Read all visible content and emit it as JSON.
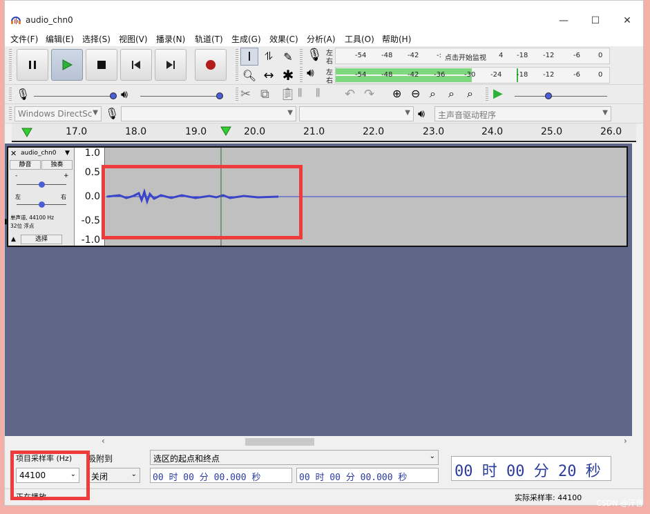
{
  "window": {
    "title": "audio_chn0",
    "minimize": "—",
    "maximize": "☐",
    "close": "✕"
  },
  "menu": [
    "文件(F)",
    "编辑(E)",
    "选择(S)",
    "视图(V)",
    "播录(N)",
    "轨道(T)",
    "生成(G)",
    "效果(C)",
    "分析(A)",
    "工具(O)",
    "帮助(H)"
  ],
  "meters": {
    "rec_lr": [
      "左",
      "右"
    ],
    "play_lr": [
      "左",
      "右"
    ],
    "rec_scale": [
      "-54",
      "-48",
      "-42",
      "-:",
      "点击开始监视",
      "4",
      "-18",
      "-12",
      "-6",
      "0"
    ],
    "play_scale": [
      "-54",
      "-48",
      "-42",
      "-36",
      "-30",
      "-24",
      "-18",
      "-12",
      "-6",
      "0"
    ]
  },
  "device": {
    "host": "Windows DirectSc",
    "input_device": "",
    "input_channels": "",
    "output_device": "主声音驱动程序"
  },
  "ruler": [
    "17.0",
    "18.0",
    "19.0",
    "20.0",
    "21.0",
    "22.0",
    "23.0",
    "24.0",
    "25.0",
    "26.0"
  ],
  "track": {
    "name": "audio_chn0",
    "mute": "静音",
    "solo": "独奏",
    "pan_left": "左",
    "pan_right": "右",
    "info1": "单声道, 44100 Hz",
    "info2": "32位 浮点",
    "select": "选择",
    "vruler": [
      "1.0",
      "0.5",
      "0.0",
      "-0.5",
      "-1.0"
    ]
  },
  "bottom": {
    "rate_label": "项目采样率 (Hz)",
    "rate_value": "44100",
    "snap_label": "吸附到",
    "snap_value": "关闭",
    "sel_mode": "选区的起点和终点",
    "sel_start": "00 时 00 分 00.000 秒",
    "sel_end": "00 时 00 分 00.000 秒",
    "big_time": "00 时 00 分 20 秒"
  },
  "status": {
    "left": "正在播放.",
    "rate": "实际采样率: 44100"
  },
  "watermark": "CSDN @汗音",
  "colors": {
    "accent": "#3a44c8",
    "meter_green": "#7ed87e",
    "highlight": "#ee3b3b",
    "track_bg": "#5f6688"
  }
}
